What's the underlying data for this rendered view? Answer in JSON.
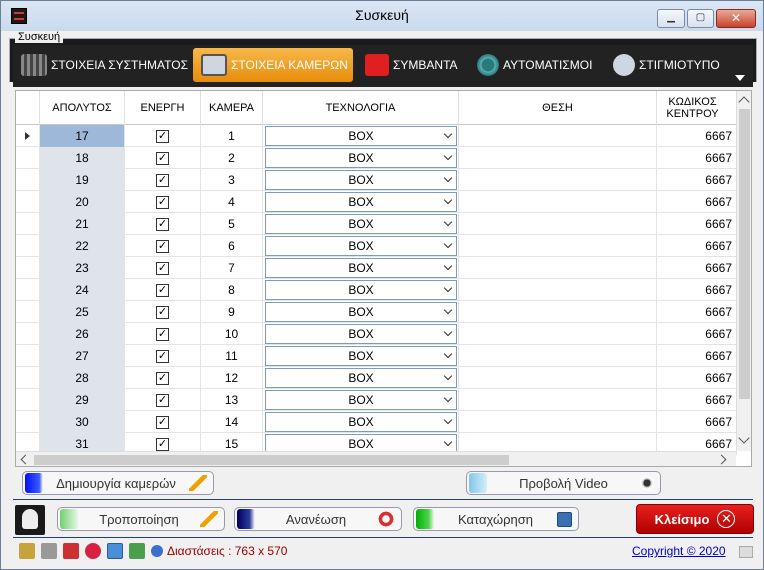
{
  "window": {
    "title": "Συσκευή"
  },
  "group": {
    "label": "Συσκευή"
  },
  "tabs": [
    {
      "label": "ΣΤΟΙΧΕΙΑ ΣΥΣΤΗΜΑΤΟΣ",
      "active": false,
      "icon": "server-rack-icon"
    },
    {
      "label": "ΣΤΟΙΧΕΙΑ ΚΑΜΕΡΩΝ",
      "active": true,
      "icon": "camera-icon"
    },
    {
      "label": "ΣΥΜΒΑΝΤΑ",
      "active": false,
      "icon": "bell-icon"
    },
    {
      "label": "ΑΥΤΟΜΑΤΙΣΜΟΙ",
      "active": false,
      "icon": "clock-icon"
    },
    {
      "label": "ΣΤΙΓΜΙΟΤΥΠΟ",
      "active": false,
      "icon": "snapshot-icon"
    }
  ],
  "grid": {
    "headers": {
      "absolute": "ΑΠΟΛΥΤΟΣ",
      "active": "ΕΝΕΡΓΗ",
      "camera": "ΚΑΜΕΡΑ",
      "technology": "ΤΕΧΝΟΛΟΓΙΑ",
      "position": "ΘΕΣΗ",
      "center_code": "ΚΩΔΙΚΟΣ ΚΕΝΤΡΟΥ"
    },
    "rows": [
      {
        "absolute": "17",
        "active": "✓",
        "camera": "1",
        "technology": "BOX",
        "position": "",
        "center_code": "6667"
      },
      {
        "absolute": "18",
        "active": "✓",
        "camera": "2",
        "technology": "BOX",
        "position": "",
        "center_code": "6667"
      },
      {
        "absolute": "19",
        "active": "✓",
        "camera": "3",
        "technology": "BOX",
        "position": "",
        "center_code": "6667"
      },
      {
        "absolute": "20",
        "active": "✓",
        "camera": "4",
        "technology": "BOX",
        "position": "",
        "center_code": "6667"
      },
      {
        "absolute": "21",
        "active": "✓",
        "camera": "5",
        "technology": "BOX",
        "position": "",
        "center_code": "6667"
      },
      {
        "absolute": "22",
        "active": "✓",
        "camera": "6",
        "technology": "BOX",
        "position": "",
        "center_code": "6667"
      },
      {
        "absolute": "23",
        "active": "✓",
        "camera": "7",
        "technology": "BOX",
        "position": "",
        "center_code": "6667"
      },
      {
        "absolute": "24",
        "active": "✓",
        "camera": "8",
        "technology": "BOX",
        "position": "",
        "center_code": "6667"
      },
      {
        "absolute": "25",
        "active": "✓",
        "camera": "9",
        "technology": "BOX",
        "position": "",
        "center_code": "6667"
      },
      {
        "absolute": "26",
        "active": "✓",
        "camera": "10",
        "technology": "BOX",
        "position": "",
        "center_code": "6667"
      },
      {
        "absolute": "27",
        "active": "✓",
        "camera": "11",
        "technology": "BOX",
        "position": "",
        "center_code": "6667"
      },
      {
        "absolute": "28",
        "active": "✓",
        "camera": "12",
        "technology": "BOX",
        "position": "",
        "center_code": "6667"
      },
      {
        "absolute": "29",
        "active": "✓",
        "camera": "13",
        "technology": "BOX",
        "position": "",
        "center_code": "6667"
      },
      {
        "absolute": "30",
        "active": "✓",
        "camera": "14",
        "technology": "BOX",
        "position": "",
        "center_code": "6667"
      },
      {
        "absolute": "31",
        "active": "✓",
        "camera": "15",
        "technology": "BOX",
        "position": "",
        "center_code": "6667"
      }
    ]
  },
  "buttons": {
    "create_cameras": "Δημιουργία καμερών",
    "view_video": "Προβολή Video",
    "edit": "Τροποποίηση",
    "refresh": "Ανανέωση",
    "save": "Καταχώρηση",
    "close": "Κλείσιμο"
  },
  "status": {
    "dimensions": "Διαστάσεις : 763 x 570",
    "copyright": "Copyright ©  2020"
  },
  "colors": {
    "active_tab": "#e88d0c",
    "close_button": "#d00000",
    "dimension_text": "#a00000",
    "link": "#0000cc"
  }
}
